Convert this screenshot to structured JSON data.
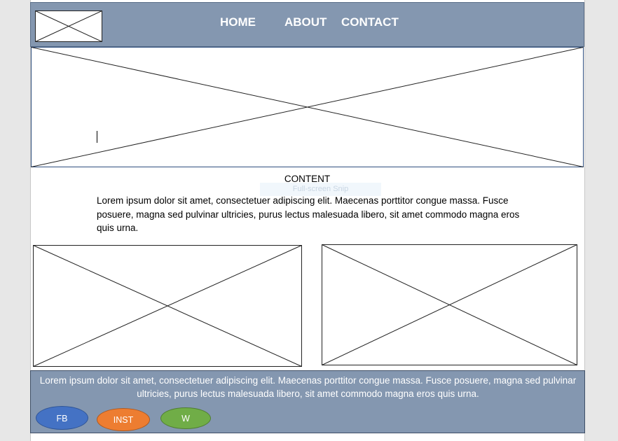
{
  "header": {
    "nav": {
      "home": "HOME",
      "about": "ABOUT",
      "contact": "CONTACT"
    }
  },
  "content": {
    "title": "CONTENT",
    "text": "Lorem ipsum dolor sit amet, consectetuer adipiscing elit. Maecenas porttitor congue massa. Fusce posuere, magna sed pulvinar ultricies, purus lectus malesuada libero, sit amet commodo magna eros quis urna."
  },
  "overlay": {
    "tooltip": "Full-screen Snip"
  },
  "footer": {
    "text": "Lorem ipsum dolor sit amet, consectetuer adipiscing elit. Maecenas porttitor congue massa. Fusce posuere, magna sed pulvinar ultricies, purus lectus malesuada libero, sit amet commodo magna eros quis urna.",
    "social": {
      "fb": "FB",
      "inst": "INST",
      "w": "W"
    }
  },
  "colors": {
    "header_bg": "#8497b0",
    "fb": "#4472c4",
    "inst": "#ed7d31",
    "w": "#70ad47"
  }
}
